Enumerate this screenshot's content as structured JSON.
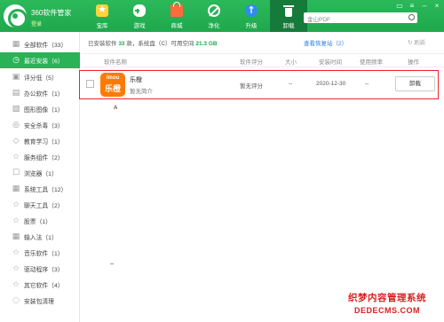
{
  "app": {
    "name": "360软件管家",
    "login": "登录"
  },
  "nav": [
    {
      "label": "宝库",
      "icon": "store-star-icon"
    },
    {
      "label": "游戏",
      "icon": "gamepad-icon"
    },
    {
      "label": "商城",
      "icon": "shopping-bag-icon"
    },
    {
      "label": "净化",
      "icon": "clean-icon"
    },
    {
      "label": "升级",
      "icon": "upgrade-arrow-icon"
    },
    {
      "label": "卸载",
      "icon": "trash-icon",
      "active": true
    }
  ],
  "search": {
    "placeholder": "金山PDF"
  },
  "sidebar": [
    {
      "label": "全部软件（33）",
      "icon": "grid-icon"
    },
    {
      "label": "最近安装（6）",
      "icon": "clock-icon",
      "active": true
    },
    {
      "label": "评分低（5）",
      "icon": "rating-icon"
    },
    {
      "label": "办公软件（1）",
      "icon": "office-icon"
    },
    {
      "label": "图形图像（1）",
      "icon": "image-icon"
    },
    {
      "label": "安全杀毒（3）",
      "icon": "shield-icon"
    },
    {
      "label": "教育学习（1）",
      "icon": "education-icon"
    },
    {
      "label": "服务组件（2）",
      "icon": "star-icon"
    },
    {
      "label": "浏览器（1）",
      "icon": "browser-icon"
    },
    {
      "label": "系统工具（12）",
      "icon": "system-grid-icon"
    },
    {
      "label": "聊天工具（2）",
      "icon": "chat-star-icon"
    },
    {
      "label": "股票（1）",
      "icon": "stock-star-icon"
    },
    {
      "label": "输入法（1）",
      "icon": "input-grid-icon"
    },
    {
      "label": "音乐软件（1）",
      "icon": "music-star-icon"
    },
    {
      "label": "驱动程序（3）",
      "icon": "driver-star-icon"
    },
    {
      "label": "其它软件（4）",
      "icon": "other-star-icon"
    },
    {
      "label": "安装包清理",
      "icon": "package-clean-icon"
    }
  ],
  "info": {
    "prefix": "已安装软件",
    "count": "33",
    "mid": "款，系统盘（C）可用空间",
    "space": "21.3 GB",
    "recycle": "查看恢复站（2）",
    "refresh": "刷新"
  },
  "table": {
    "headers": [
      "软件名称",
      "软件评分",
      "大小",
      "安装时间",
      "使用频率",
      "操作"
    ],
    "rows": [
      {
        "icon_text_top": "imou",
        "icon_text_main": "乐橙",
        "name": "乐橙",
        "desc": "暂无简介",
        "rating": "暂无评分",
        "size": "--",
        "date": "2020-12-30",
        "freq": "--",
        "action": "卸载"
      }
    ]
  },
  "watermark": {
    "line1": "织梦内容管理系统",
    "line2": "DEDECMS.COM"
  },
  "stray": {
    "mark": "A"
  },
  "colors": {
    "brand_green": "#1fa84d",
    "highlight_red": "#e8262e",
    "app_orange": "#ff7a00",
    "link_blue": "#2e7ee0"
  }
}
